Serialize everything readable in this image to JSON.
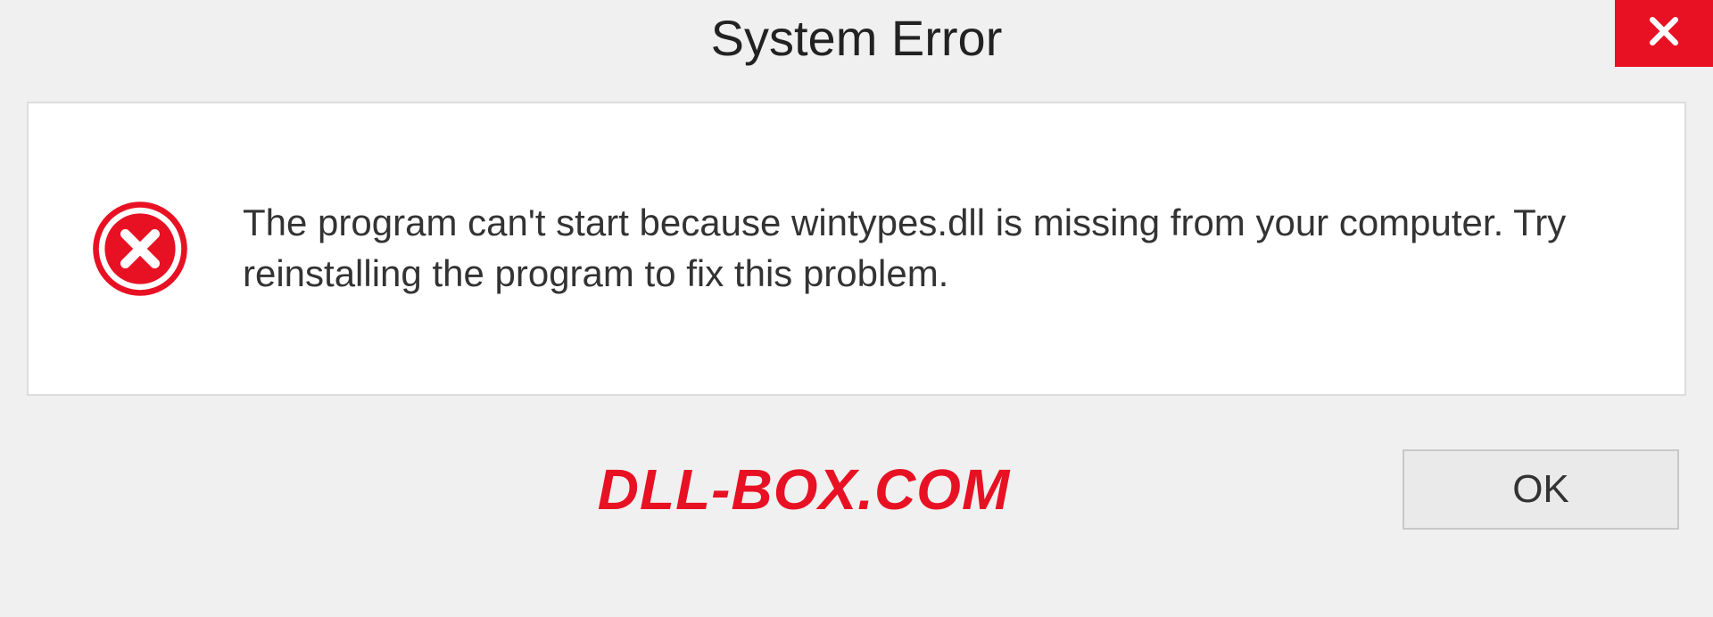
{
  "dialog": {
    "title": "System Error",
    "message": "The program can't start because wintypes.dll is missing from your computer. Try reinstalling the program to fix this problem.",
    "ok_label": "OK",
    "watermark": "DLL-BOX.COM"
  },
  "colors": {
    "accent_red": "#e81123"
  }
}
